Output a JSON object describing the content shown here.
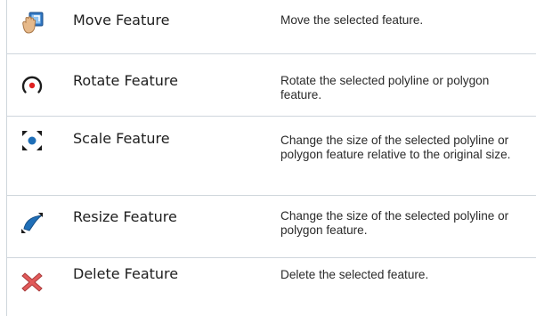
{
  "tools": [
    {
      "name": "Move Feature",
      "description": "Move the selected feature.",
      "icon": "move-feature-icon"
    },
    {
      "name": "Rotate Feature",
      "description": "Rotate the selected polyline or polygon feature.",
      "icon": "rotate-feature-icon"
    },
    {
      "name": "Scale Feature",
      "description": "Change the size of the selected polyline or polygon feature relative to the original size.",
      "icon": "scale-feature-icon"
    },
    {
      "name": "Resize Feature",
      "description": "Change the size of the selected polyline or polygon feature.",
      "icon": "resize-feature-icon"
    },
    {
      "name": "Delete Feature",
      "description": "Delete the selected feature.",
      "icon": "delete-feature-icon"
    }
  ],
  "colors": {
    "border": "#cfd6dc",
    "accent_blue": "#1f6fb8",
    "delete_red": "#d94a4a"
  }
}
